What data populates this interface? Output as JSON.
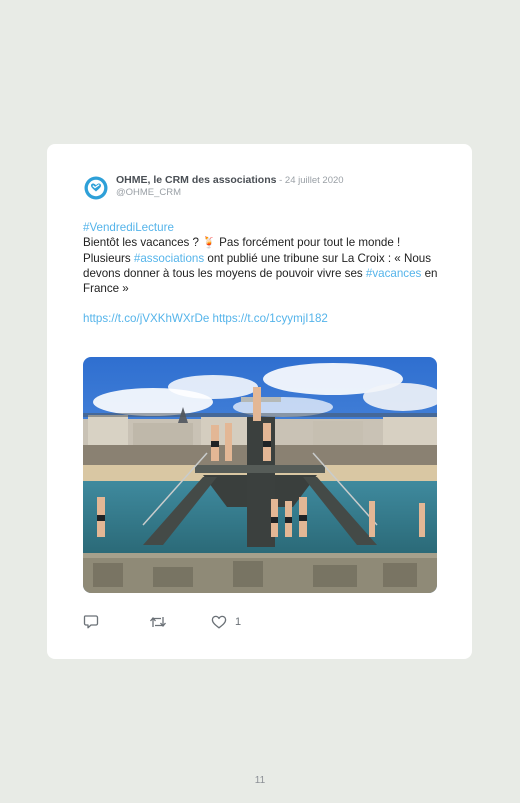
{
  "tweet": {
    "author_name": "OHME, le CRM des associations",
    "date": " - 24 juillet 2020",
    "handle": "@OHME_CRM",
    "hashtag_vendredi": "#VendrediLecture",
    "line1_text": "Bientôt les vacances ? ",
    "line1_emoji": "🍹",
    "line1_rest": " Pas forcément pour tout le monde !",
    "line2_pre": "Plusieurs ",
    "hashtag_associations": "#associations",
    "line2_post": " ont publié une tribune sur La Croix : « Nous devons donner à tous les moyens de pouvoir vivre ses ",
    "hashtag_vacances": "#vacances",
    "line2_end": " en France »",
    "link1": "https://t.co/jVXKhWXrDe",
    "link_separator": " ",
    "link2": "https://t.co/1cyymjI182",
    "like_count": "1"
  },
  "icons": {
    "avatar": "ohme-logo",
    "reply": "reply-icon",
    "retweet": "retweet-icon",
    "like": "heart-icon"
  },
  "colors": {
    "accent_link": "#55b4ea",
    "brand_logo": "#2ea0d8"
  },
  "page": {
    "number": "11"
  }
}
